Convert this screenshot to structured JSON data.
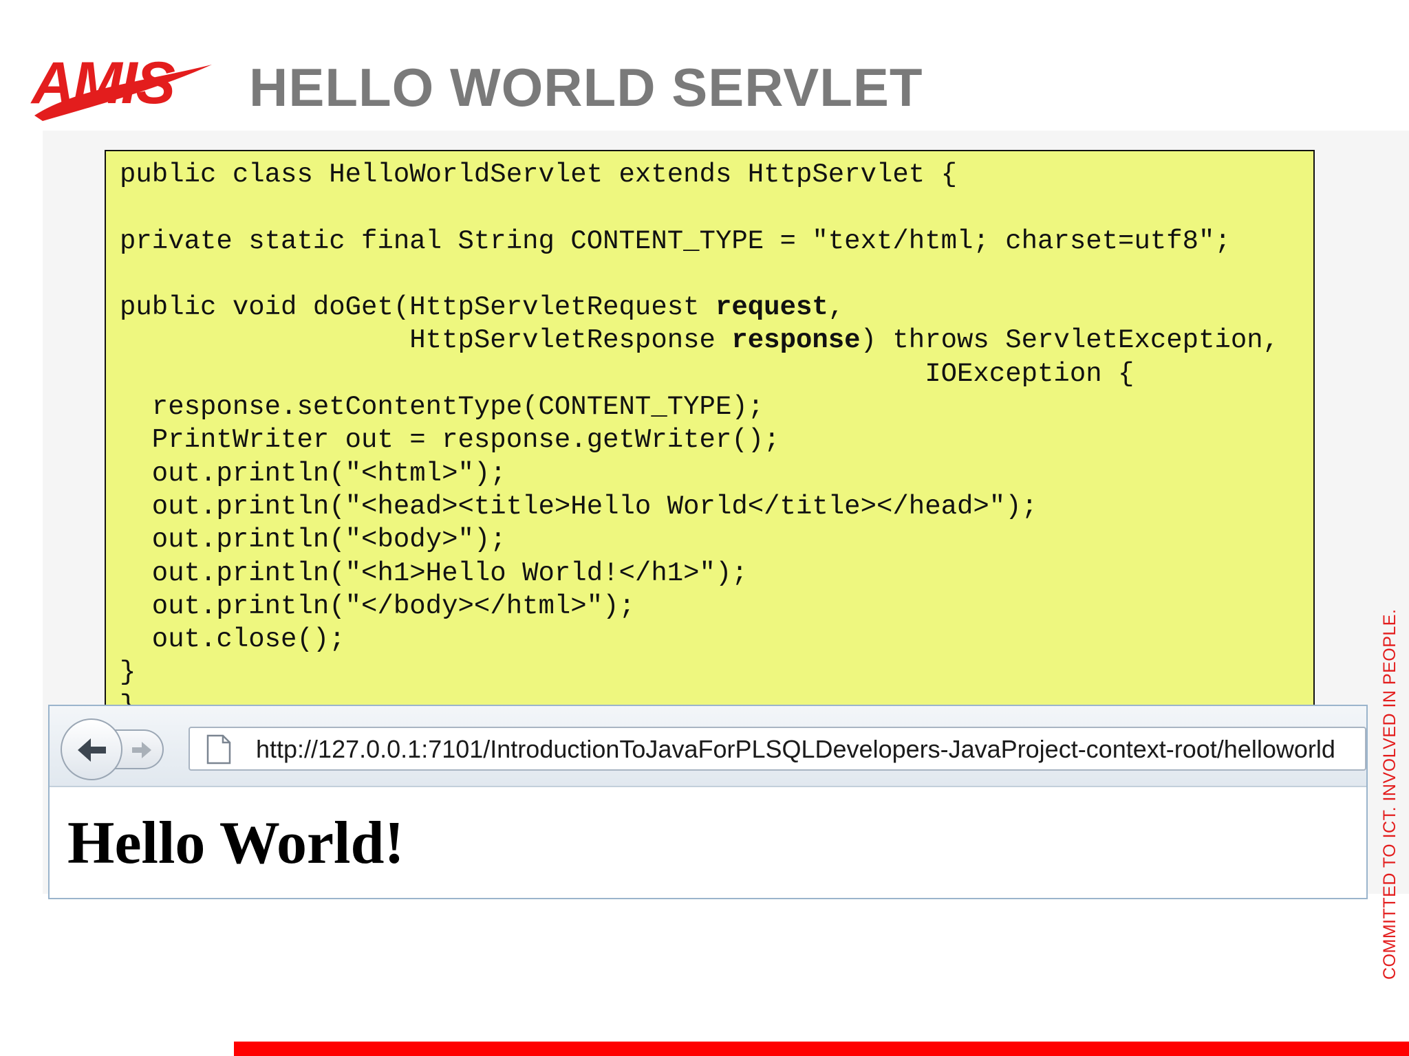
{
  "logo": {
    "text": "AMIS",
    "color": "#e31d1d"
  },
  "slide": {
    "title": "HELLO WORLD SERVLET"
  },
  "code": {
    "background": "#eef77f",
    "line1": "public class HelloWorldServlet extends HttpServlet {",
    "line3": "private static final String CONTENT_TYPE = \"text/html; charset=utf8\";",
    "line5a": "public void doGet(HttpServletRequest ",
    "line5b": "request",
    "line5c": ",",
    "line6a": "                  HttpServletResponse ",
    "line6b": "response",
    "line6c": ") throws ServletException,",
    "line7": "                                                  IOException {",
    "line8": "  response.setContentType(CONTENT_TYPE);",
    "line9": "  PrintWriter out = response.getWriter();",
    "line10": "  out.println(\"<html>\");",
    "line11": "  out.println(\"<head><title>Hello World</title></head>\");",
    "line12": "  out.println(\"<body>\");",
    "line13": "  out.println(\"<h1>Hello World!</h1>\");",
    "line14": "  out.println(\"</body></html>\");",
    "line15": "  out.close();",
    "line16": "}",
    "line17": "}"
  },
  "browser": {
    "back_icon": "back-arrow-icon",
    "forward_icon": "forward-arrow-icon",
    "page_icon": "page-icon",
    "url": "http://127.0.0.1:7101/IntroductionToJavaForPLSQLDevelopers-JavaProject-context-root/helloworld",
    "page_heading": "Hello World!"
  },
  "tagline": "COMMITTED TO ICT. INVOLVED IN PEOPLE.",
  "colors": {
    "accent": "#ff0000",
    "title_gray": "#7a7a7a"
  }
}
